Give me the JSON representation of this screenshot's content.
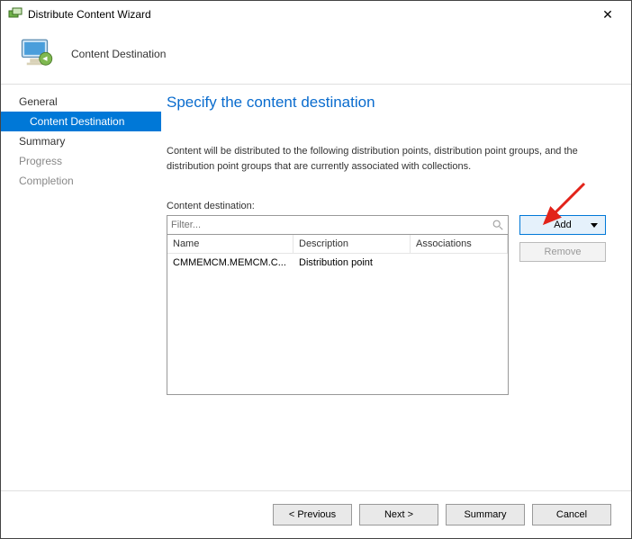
{
  "window": {
    "title": "Distribute Content Wizard"
  },
  "header": {
    "heading": "Content Destination"
  },
  "sidebar": {
    "steps": {
      "general": "General",
      "content_destination": "Content Destination",
      "summary": "Summary",
      "progress": "Progress",
      "completion": "Completion"
    }
  },
  "main": {
    "title": "Specify the content destination",
    "description": "Content will be distributed to the following distribution points, distribution point groups, and the distribution point groups that are currently associated with collections.",
    "dest_label": "Content destination:",
    "filter_placeholder": "Filter...",
    "columns": {
      "name": "Name",
      "description": "Description",
      "associations": "Associations"
    },
    "rows": [
      {
        "name": "CMMEMCM.MEMCM.C...",
        "description": "Distribution point",
        "associations": ""
      }
    ],
    "buttons": {
      "add": "Add",
      "remove": "Remove"
    }
  },
  "footer": {
    "previous": "< Previous",
    "next": "Next >",
    "summary": "Summary",
    "cancel": "Cancel"
  }
}
